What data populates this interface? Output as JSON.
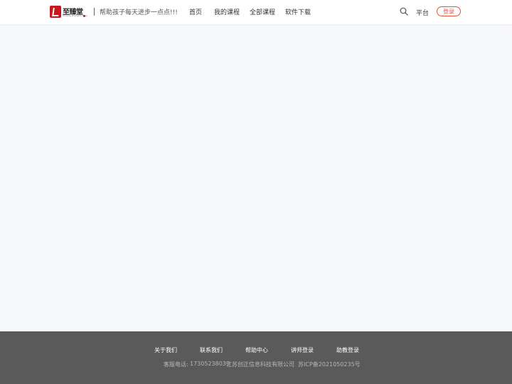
{
  "header": {
    "logo": {
      "name": "至臻堂",
      "subtitle": "Chuang Zhengxin Tang"
    },
    "slogan": "帮助孩子每天进步一点点!!!",
    "nav": [
      "首页",
      "我的课程",
      "全部课程",
      "软件下载"
    ],
    "platform_label": "平台",
    "login_label": "登录",
    "search_icon": "search-icon"
  },
  "footer": {
    "links": [
      "关于我们",
      "联系我们",
      "帮助中心",
      "讲师登录",
      "助教登录"
    ],
    "phone_label": "客服电话:",
    "phone": "17305238039",
    "company": "江苏创正信息科技有限公司",
    "icp": "苏ICP备2021050235号"
  },
  "colors": {
    "accent": "#e8503e",
    "brand_red": "#c8161d",
    "footer_bg": "#5a5a5a",
    "page_bg": "#f7f8fa"
  }
}
